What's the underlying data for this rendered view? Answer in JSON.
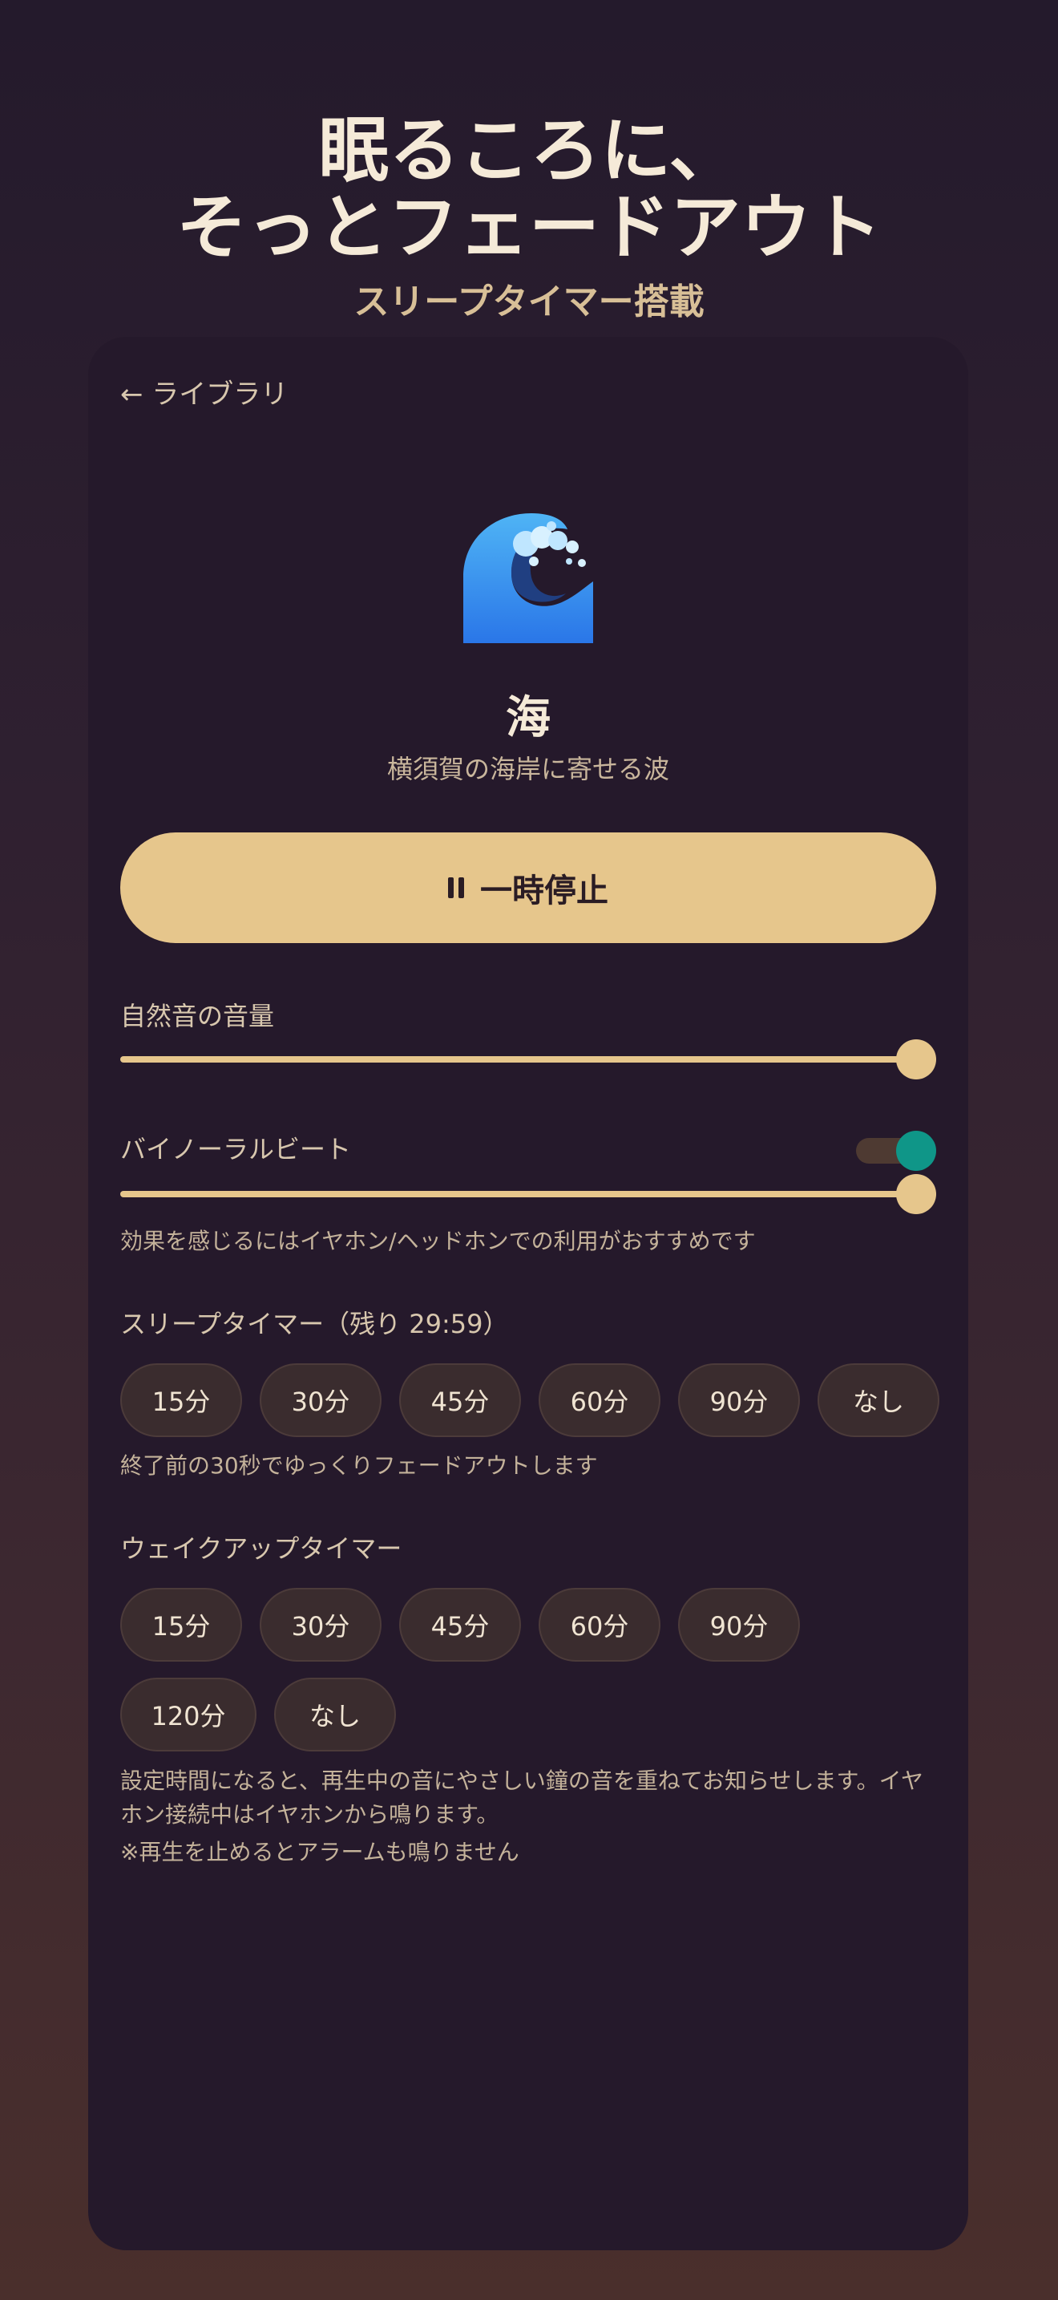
{
  "hero": {
    "title_line1": "眠るころに、",
    "title_line2": "そっとフェードアウト",
    "subtitle": "スリープタイマー搭載"
  },
  "nav": {
    "back_label": "← ライブラリ"
  },
  "sound": {
    "icon": "water-wave-icon",
    "name": "海",
    "description": "横須賀の海岸に寄せる波"
  },
  "playback": {
    "pause_label": "一時停止"
  },
  "volume": {
    "label": "自然音の音量",
    "value": 1.0
  },
  "binaural": {
    "label": "バイノーラルビート",
    "enabled": true,
    "value": 1.0,
    "note": "効果を感じるにはイヤホン/ヘッドホンでの利用がおすすめです"
  },
  "sleep_timer": {
    "label": "スリープタイマー（残り 29:59）",
    "options": [
      "15分",
      "30分",
      "45分",
      "60分",
      "90分",
      "なし"
    ],
    "note": "終了前の30秒でゆっくりフェードアウトします"
  },
  "wakeup_timer": {
    "label": "ウェイクアップタイマー",
    "options_row1": [
      "15分",
      "30分",
      "45分",
      "60分",
      "90分"
    ],
    "options_row2": [
      "120分",
      "なし"
    ],
    "note1": "設定時間になると、再生中の音にやさしい鐘の音を重ねてお知らせします。イヤホン接続中はイヤホンから鳴ります。",
    "note2": "※再生を止めるとアラームも鳴りません"
  },
  "colors": {
    "accent": "#e6c68c",
    "toggle_on": "#0f9688",
    "card_bg": "#25192b"
  }
}
